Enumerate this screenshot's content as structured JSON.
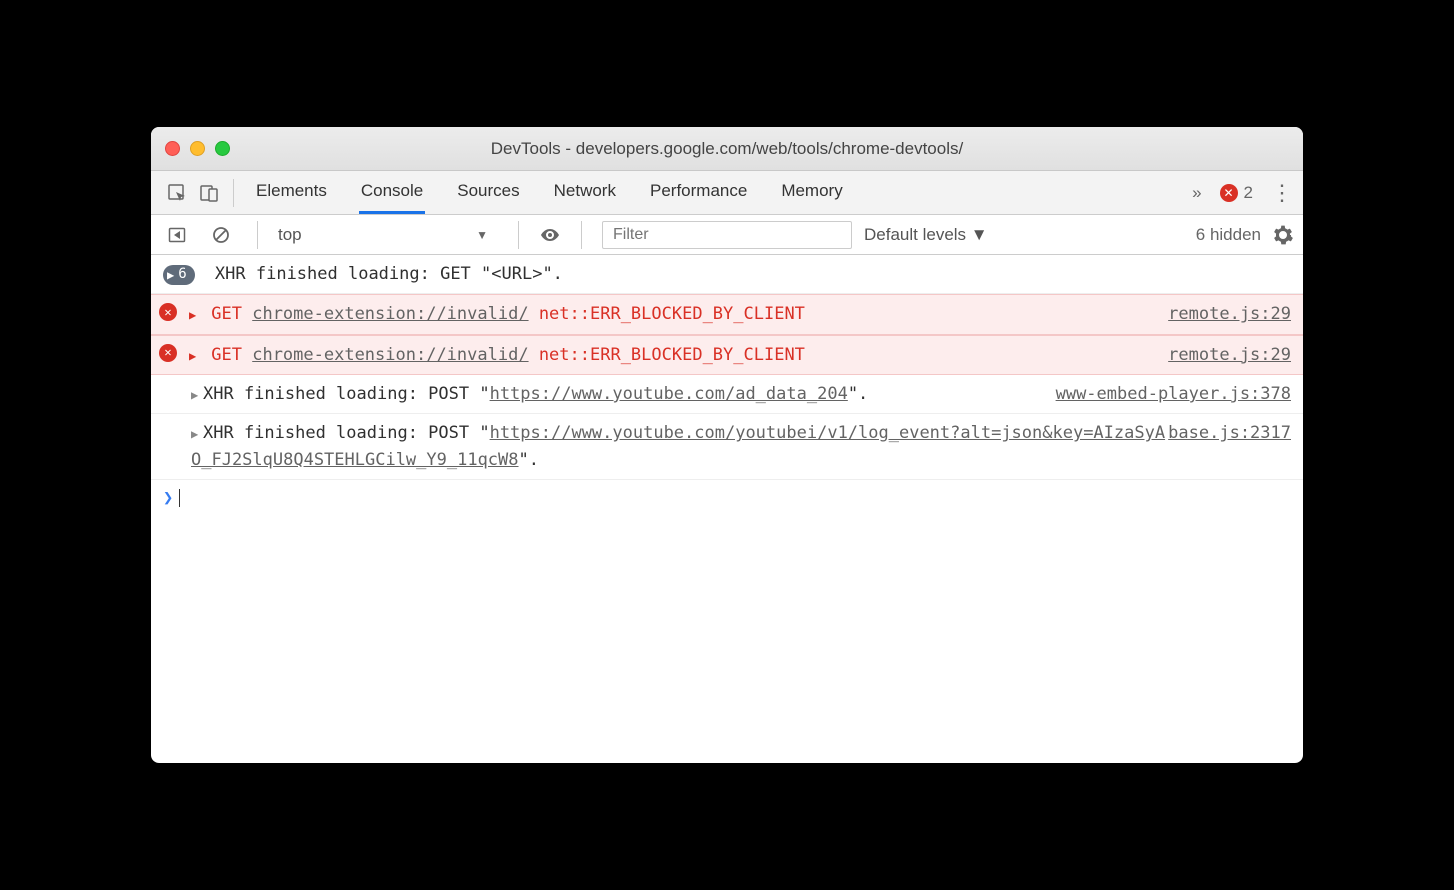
{
  "window": {
    "title": "DevTools - developers.google.com/web/tools/chrome-devtools/"
  },
  "tabs": [
    "Elements",
    "Console",
    "Sources",
    "Network",
    "Performance",
    "Memory"
  ],
  "activeTab": "Console",
  "overflow": "»",
  "errorCount": "2",
  "toolbar": {
    "context": "top",
    "filterPlaceholder": "Filter",
    "levels": "Default levels ▼",
    "hidden": "6 hidden"
  },
  "badge": {
    "count": "6"
  },
  "xhrIntro": "XHR finished loading: GET \"<URL>\".",
  "errRows": [
    {
      "method": "GET",
      "url": "chrome-extension://invalid/",
      "err": "net::ERR_BLOCKED_BY_CLIENT",
      "src": "remote.js:29"
    },
    {
      "method": "GET",
      "url": "chrome-extension://invalid/",
      "err": "net::ERR_BLOCKED_BY_CLIENT",
      "src": "remote.js:29"
    }
  ],
  "logs": [
    {
      "prefix": "XHR finished loading: POST \"",
      "url": "https://www.youtube.com/ad_data_204",
      "suffix": "\".",
      "src": "www-embed-player.js:378"
    },
    {
      "prefix": "XHR finished loading: POST \"",
      "url": "https://www.youtube.com/youtubei/v1/log_event?alt=json&key=AIzaSyAO_FJ2SlqU8Q4STEHLGCilw_Y9_11qcW8",
      "suffix": "\".",
      "src": "base.js:2317"
    }
  ]
}
